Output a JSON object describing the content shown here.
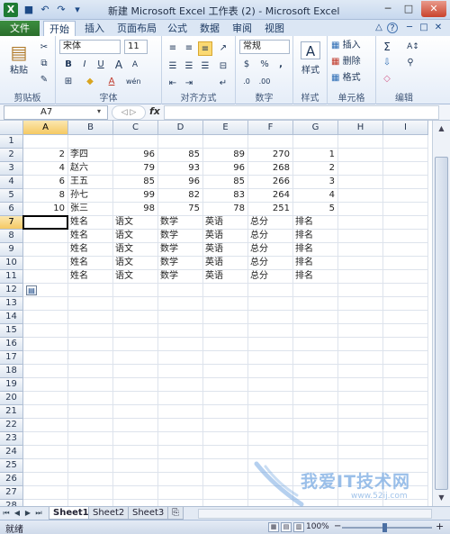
{
  "window": {
    "title": "新建 Microsoft Excel 工作表 (2) - Microsoft Excel",
    "minimize": "─",
    "maximize": "□",
    "close": "✕"
  },
  "quick_access": {
    "excel_icon": "X",
    "save_icon": "■",
    "undo_icon": "↶",
    "redo_icon": "↷",
    "customize_icon": "▾"
  },
  "tabs": {
    "file": "文件",
    "items": [
      "开始",
      "插入",
      "页面布局",
      "公式",
      "数据",
      "审阅",
      "视图"
    ],
    "active_index": 0,
    "help_icon": "?",
    "minimize_ribbon_icon": "△"
  },
  "ribbon": {
    "clipboard": {
      "label": "剪贴板",
      "paste": "粘贴",
      "paste_icon": "▤"
    },
    "font": {
      "label": "字体",
      "font_name": "宋体",
      "font_size": "11",
      "bold": "B",
      "italic": "I",
      "underline": "U",
      "grow": "A",
      "shrink": "A",
      "border_icon": "⊞",
      "fill_icon": "◆",
      "color_icon": "A",
      "phonetic": "wén"
    },
    "alignment": {
      "label": "对齐方式"
    },
    "number": {
      "label": "数字",
      "format": "常规",
      "currency": "$",
      "percent": "%",
      "comma": ","
    },
    "styles": {
      "label": "样式",
      "button": "样式",
      "icon": "A"
    },
    "cells": {
      "label": "单元格",
      "insert": "插入",
      "delete": "删除",
      "format": "格式"
    },
    "editing": {
      "label": "编辑",
      "sum_icon": "Σ",
      "fill_icon": "⇩",
      "clear_icon": "◇",
      "sort_icon": "A↕",
      "find_icon": "⚲"
    }
  },
  "formula_bar": {
    "name_box": "A7",
    "fx": "fx",
    "value": ""
  },
  "sheet": {
    "columns": [
      "A",
      "B",
      "C",
      "D",
      "E",
      "F",
      "G",
      "H",
      "I"
    ],
    "rows": [
      "1",
      "2",
      "3",
      "4",
      "5",
      "6",
      "7",
      "8",
      "9",
      "10",
      "11",
      "12",
      "13",
      "14",
      "15",
      "16",
      "17",
      "18",
      "19",
      "20",
      "21",
      "22",
      "23",
      "24",
      "25",
      "26",
      "27",
      "28"
    ],
    "data_rows": [
      [
        "2",
        "李四",
        "96",
        "85",
        "89",
        "270",
        "1"
      ],
      [
        "4",
        "赵六",
        "79",
        "93",
        "96",
        "268",
        "2"
      ],
      [
        "6",
        "王五",
        "85",
        "96",
        "85",
        "266",
        "3"
      ],
      [
        "8",
        "孙七",
        "99",
        "82",
        "83",
        "264",
        "4"
      ],
      [
        "10",
        "张三",
        "98",
        "75",
        "78",
        "251",
        "5"
      ]
    ],
    "header_rows": [
      [
        "姓名",
        "语文",
        "数学",
        "英语",
        "总分",
        "排名"
      ],
      [
        "姓名",
        "语文",
        "数学",
        "英语",
        "总分",
        "排名"
      ],
      [
        "姓名",
        "语文",
        "数学",
        "英语",
        "总分",
        "排名"
      ],
      [
        "姓名",
        "语文",
        "数学",
        "英语",
        "总分",
        "排名"
      ],
      [
        "姓名",
        "语文",
        "数学",
        "英语",
        "总分",
        "排名"
      ]
    ],
    "active_cell": "A7"
  },
  "sheet_tabs": {
    "items": [
      "Sheet1",
      "Sheet2",
      "Sheet3"
    ],
    "active_index": 0,
    "insert_icon": "⎘",
    "nav": [
      "⏮",
      "◀",
      "▶",
      "⏭"
    ]
  },
  "status_bar": {
    "text": "就绪",
    "zoom": "100%",
    "zoom_out": "−",
    "zoom_in": "+"
  },
  "watermark": {
    "text": "我爱IT技术网",
    "sub": "www.52ij.com"
  }
}
